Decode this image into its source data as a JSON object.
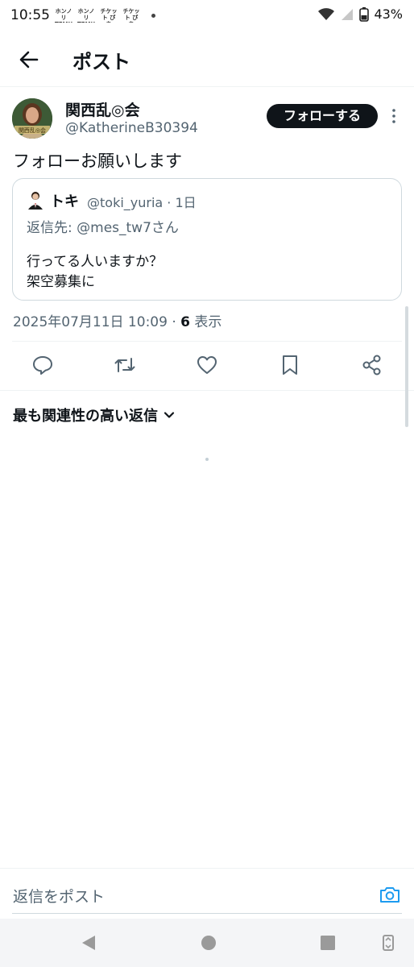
{
  "status_bar": {
    "time": "10:55",
    "notifications": [
      "ホンノリ TEMU",
      "ホンノリ TEMU",
      "チケット ぴあ",
      "チケット ぴあ"
    ],
    "battery": "43%"
  },
  "header": {
    "title": "ポスト"
  },
  "post": {
    "author_name": "関西乱◎会",
    "author_handle": "@KatherineB30394",
    "avatar_text": "関西乱◎会",
    "follow_label": "フォローする",
    "text": "フォローお願いします",
    "timestamp": "2025年07月11日 10:09 · ",
    "views_count": "6",
    "views_label": " 表示"
  },
  "quote": {
    "name": "トキ",
    "handle_time": "@toki_yuria · 1日",
    "reply_to": "返信先: @mes_tw7さん",
    "line1": "行ってる人いますか？",
    "line2": "架空募集に"
  },
  "replies": {
    "sort_label": "最も関連性の高い返信"
  },
  "composer": {
    "placeholder": "返信をポスト"
  },
  "colors": {
    "text": "#0f1419",
    "secondary": "#536471",
    "accent": "#1d9bf0"
  },
  "icons": [
    "back-arrow-icon",
    "more-vertical-icon",
    "reply-icon",
    "retweet-icon",
    "like-icon",
    "bookmark-icon",
    "share-icon",
    "chevron-down-icon",
    "camera-icon"
  ]
}
